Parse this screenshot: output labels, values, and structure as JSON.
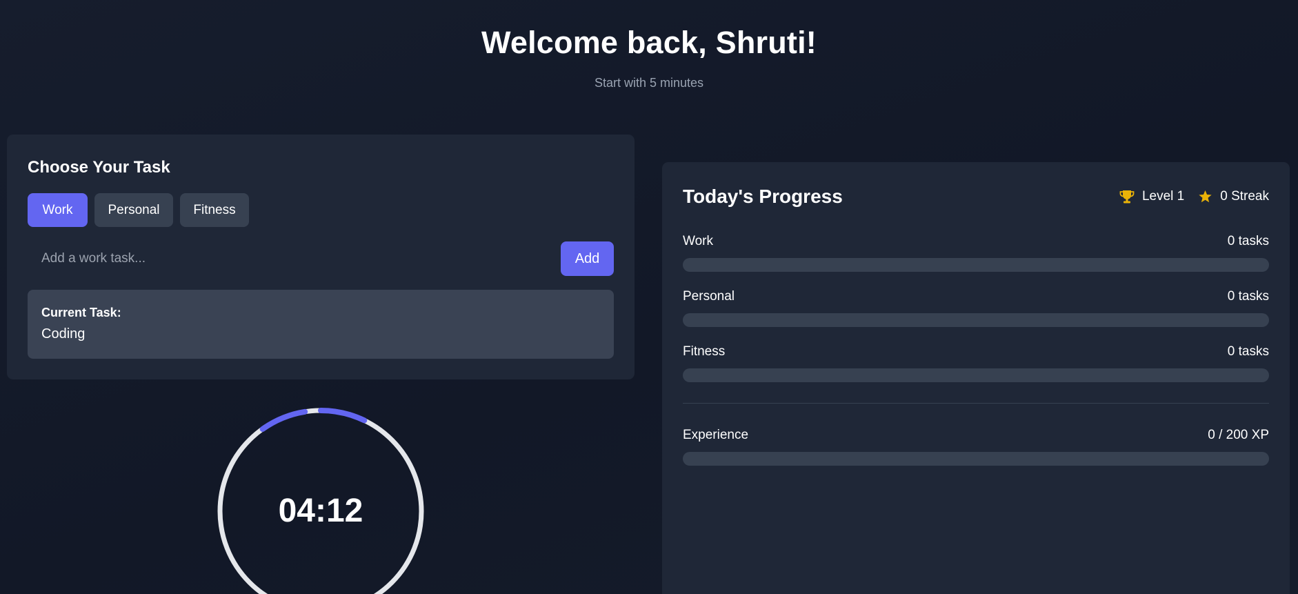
{
  "header": {
    "title": "Welcome back, Shruti!",
    "subtitle": "Start with 5 minutes"
  },
  "task_panel": {
    "title": "Choose Your Task",
    "categories": [
      "Work",
      "Personal",
      "Fitness"
    ],
    "active_category": "Work",
    "input_placeholder": "Add a work task...",
    "input_value": "",
    "add_label": "Add",
    "current_task_label": "Current Task:",
    "current_task_value": "Coding"
  },
  "timer": {
    "display": "04:12",
    "track_color": "#e5e7eb",
    "accent_color": "#6366f1"
  },
  "progress": {
    "title": "Today's Progress",
    "level_icon": "trophy-icon",
    "level": "Level 1",
    "streak_icon": "star-icon",
    "streak": "0 Streak",
    "rows": [
      {
        "label": "Work",
        "value": "0 tasks",
        "fill": 0
      },
      {
        "label": "Personal",
        "value": "0 tasks",
        "fill": 0
      },
      {
        "label": "Fitness",
        "value": "0 tasks",
        "fill": 0
      }
    ],
    "experience": {
      "label": "Experience",
      "value": "0 / 200 XP",
      "fill": 0
    }
  },
  "colors": {
    "accent": "#6366f1",
    "panel": "#1f2737",
    "button_inactive": "#374151",
    "trophy": "#eab308"
  }
}
